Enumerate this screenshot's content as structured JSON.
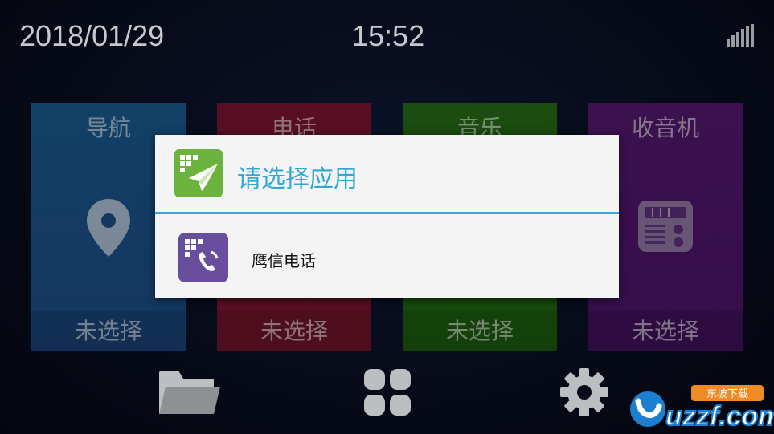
{
  "status_bar": {
    "date": "2018/01/29",
    "time": "15:52",
    "signal_icon": "signal-bars-icon"
  },
  "tiles": [
    {
      "title": "导航",
      "status": "未选择",
      "icon": "location-pin-icon",
      "color": "#195a8e"
    },
    {
      "title": "电话",
      "status": "未选择",
      "icon": "phone-icon",
      "color": "#7a1532"
    },
    {
      "title": "音乐",
      "status": "未选择",
      "icon": "music-icon",
      "color": "#276a16"
    },
    {
      "title": "收音机",
      "status": "未选择",
      "icon": "radio-icon",
      "color": "#54186e"
    }
  ],
  "dock": {
    "folder_icon": "folder-icon",
    "apps_icon": "app-grid-icon",
    "settings_icon": "gear-icon"
  },
  "dialog": {
    "title": "请选择应用",
    "title_color": "#2fa8d8",
    "items": [
      {
        "label": "鹰信电话",
        "icon": "eagle-phone-app-icon"
      }
    ]
  },
  "watermark": {
    "brand": "uzzf.com",
    "tagline": "东坡下载"
  }
}
